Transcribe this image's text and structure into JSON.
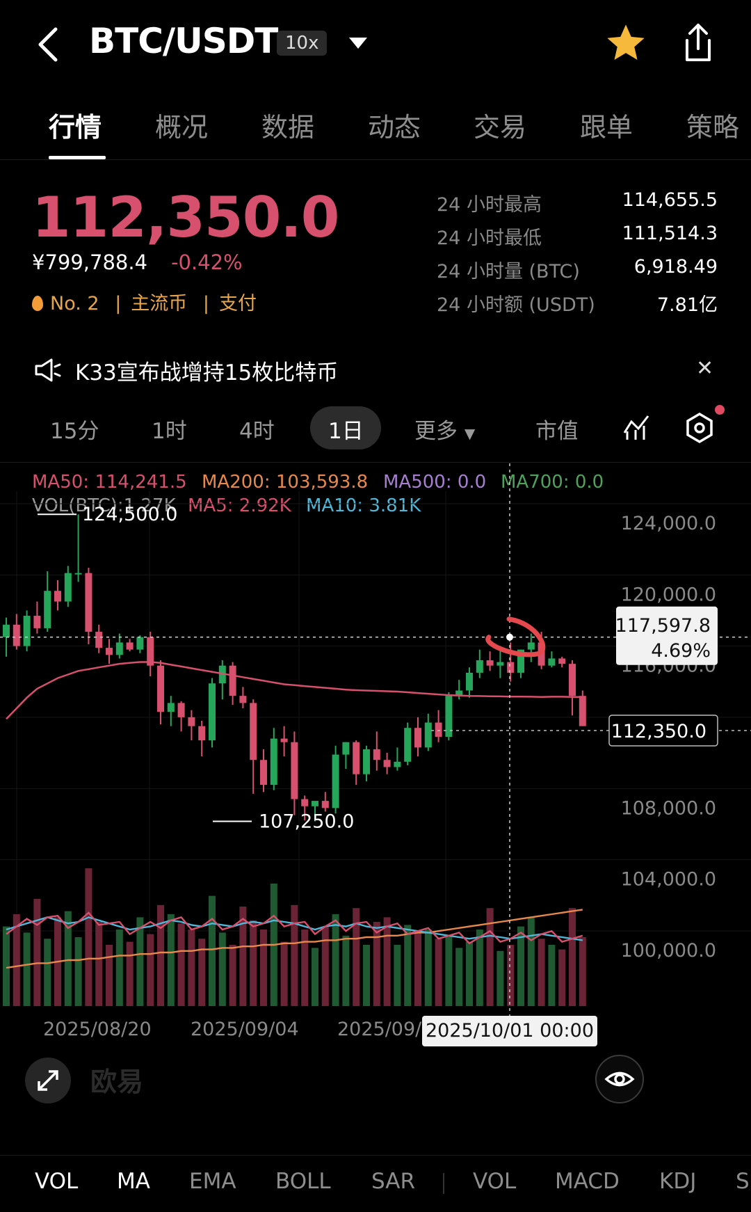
{
  "header": {
    "pair": "BTC/USDT",
    "leverage": "10x"
  },
  "tabs": [
    "行情",
    "概况",
    "数据",
    "动态",
    "交易",
    "跟单",
    "策略"
  ],
  "ticker": {
    "price": "112,350.0",
    "cny": "¥799,788.4",
    "change": "-0.42%",
    "rank": "No. 2",
    "tag1": "主流币",
    "tag2": "支付",
    "stats": [
      {
        "label": "24 小时最高",
        "value": "114,655.5"
      },
      {
        "label": "24 小时最低",
        "value": "111,514.3"
      },
      {
        "label": "24 小时量 (BTC)",
        "value": "6,918.49"
      },
      {
        "label": "24 小时额 (USDT)",
        "value": "7.81亿"
      }
    ]
  },
  "news": {
    "text": "K33宣布战增持15枚比特币"
  },
  "intervals": [
    "15分",
    "1时",
    "4时",
    "1日",
    "更多",
    "市值"
  ],
  "legend": {
    "ma50": "MA50: 114,241.5",
    "ma200": "MA200: 103,593.8",
    "ma500": "MA500: 0.0",
    "ma700": "MA700: 0.0",
    "vol": "VOL(BTC):1.27K",
    "vma5": "MA5: 2.92K",
    "vma10": "MA10: 3.81K"
  },
  "colors": {
    "up": "#26a65b",
    "down": "#d7506e",
    "ma50": "#d7506e",
    "ma200": "#e8884b",
    "ma500": "#a77fd0",
    "ma700": "#4ea35c",
    "vma10": "#4fb8d8"
  },
  "watermark": "欧易",
  "indicators": [
    "VOL",
    "MA",
    "EMA",
    "BOLL",
    "SAR",
    "VOL",
    "MACD",
    "KDJ",
    "S"
  ],
  "chart_data": {
    "type": "candlestick",
    "y_ticks": [
      "124,000.0",
      "120,000.0",
      "116,000.0",
      "112,000.0",
      "108,000.0",
      "104,000.0",
      "100,000.0"
    ],
    "x_ticks": [
      "2025/08/20",
      "2025/09/04",
      "2025/09/"
    ],
    "ylim": [
      97000,
      126000
    ],
    "high_label": "124,500.0",
    "low_label": "107,250.0",
    "crosshair": {
      "price": "117,597.8",
      "pct": "4.69%",
      "date": "2025/10/01 00:00"
    },
    "last_price": "112,350.0",
    "candles": [
      [
        117600,
        118700,
        116500,
        118300
      ],
      [
        118300,
        118900,
        116900,
        117100
      ],
      [
        117100,
        119100,
        116800,
        118800
      ],
      [
        118800,
        119600,
        117800,
        118100
      ],
      [
        118100,
        121300,
        117900,
        120200
      ],
      [
        120200,
        120800,
        119100,
        119600
      ],
      [
        119600,
        121600,
        119300,
        121200
      ],
      [
        121200,
        124500,
        120700,
        121200
      ],
      [
        121200,
        121500,
        117200,
        117900
      ],
      [
        117900,
        118300,
        116700,
        117000
      ],
      [
        117000,
        117500,
        116100,
        116600
      ],
      [
        116600,
        117800,
        116400,
        117300
      ],
      [
        117300,
        117500,
        116800,
        116900
      ],
      [
        116900,
        117700,
        116700,
        117600
      ],
      [
        117600,
        117900,
        115400,
        116000
      ],
      [
        116000,
        116300,
        112700,
        113400
      ],
      [
        113400,
        114300,
        112600,
        113900
      ],
      [
        113900,
        114000,
        112300,
        113100
      ],
      [
        113100,
        113500,
        111800,
        112600
      ],
      [
        112600,
        112900,
        110900,
        111800
      ],
      [
        111800,
        115300,
        111400,
        115000
      ],
      [
        115000,
        116300,
        114100,
        116000
      ],
      [
        116000,
        116200,
        113800,
        114300
      ],
      [
        114300,
        114800,
        113600,
        113900
      ],
      [
        113900,
        114100,
        108800,
        110700
      ],
      [
        110700,
        111300,
        108900,
        109300
      ],
      [
        109300,
        112500,
        109000,
        111900
      ],
      [
        111900,
        112600,
        110900,
        111700
      ],
      [
        111700,
        112300,
        107600,
        108500
      ],
      [
        108500,
        108700,
        107300,
        108100
      ],
      [
        108100,
        108300,
        107250,
        108400
      ],
      [
        108400,
        108900,
        107800,
        108000
      ],
      [
        108000,
        111500,
        107700,
        111000
      ],
      [
        111000,
        111700,
        110200,
        111700
      ],
      [
        111700,
        111800,
        109300,
        109900
      ],
      [
        109900,
        111500,
        109500,
        111300
      ],
      [
        111300,
        112300,
        110100,
        110700
      ],
      [
        110700,
        111100,
        109900,
        110300
      ],
      [
        110300,
        111400,
        110100,
        110600
      ],
      [
        110600,
        112800,
        110400,
        112500
      ],
      [
        112500,
        113100,
        110900,
        111400
      ],
      [
        111400,
        113300,
        111200,
        112800
      ],
      [
        112800,
        113500,
        111700,
        112000
      ],
      [
        112000,
        114500,
        111800,
        114300
      ],
      [
        114300,
        115200,
        114100,
        114600
      ],
      [
        114600,
        115900,
        114200,
        115600
      ],
      [
        115600,
        116900,
        115300,
        116300
      ],
      [
        116300,
        116800,
        115700,
        116000
      ],
      [
        116000,
        117100,
        115300,
        116200
      ],
      [
        116200,
        117300,
        115100,
        115600
      ],
      [
        115600,
        116900,
        115300,
        116900
      ],
      [
        116900,
        117800,
        116200,
        117300
      ],
      [
        117300,
        117900,
        115800,
        116000
      ],
      [
        116000,
        116800,
        115900,
        116400
      ],
      [
        116400,
        116500,
        115900,
        116100
      ],
      [
        116100,
        116300,
        113200,
        114300
      ],
      [
        114300,
        114600,
        112600,
        112600
      ]
    ],
    "ma50": [
      113000,
      113600,
      114200,
      114700,
      115000,
      115300,
      115500,
      115700,
      115800,
      115900,
      116000,
      116100,
      116150,
      116200,
      116200,
      116150,
      116050,
      115950,
      115850,
      115750,
      115650,
      115550,
      115450,
      115350,
      115250,
      115150,
      115050,
      114950,
      114900,
      114850,
      114800,
      114750,
      114700,
      114650,
      114620,
      114600,
      114580,
      114560,
      114540,
      114500,
      114460,
      114420,
      114380,
      114340,
      114320,
      114300,
      114290,
      114280,
      114270,
      114260,
      114260,
      114250,
      114240,
      114250,
      114250,
      114240,
      114241.5
    ],
    "volume": [
      52,
      60,
      48,
      70,
      44,
      58,
      62,
      45,
      90,
      55,
      40,
      50,
      42,
      58,
      47,
      66,
      60,
      54,
      50,
      44,
      72,
      48,
      40,
      65,
      56,
      50,
      80,
      42,
      66,
      50,
      38,
      52,
      60,
      46,
      64,
      40,
      55,
      58,
      40,
      53,
      48,
      50,
      44,
      46,
      38,
      42,
      50,
      64,
      36,
      40,
      52,
      58,
      44,
      40,
      37,
      64,
      45
    ],
    "vol_ma5": [
      50,
      52,
      54,
      56,
      58,
      56,
      54,
      55,
      58,
      56,
      54,
      52,
      50,
      51,
      52,
      54,
      56,
      55,
      53,
      52,
      54,
      53,
      52,
      54,
      55,
      54,
      56,
      55,
      54,
      52,
      50,
      52,
      53,
      52,
      54,
      52,
      51,
      52,
      51,
      50,
      49,
      48,
      47,
      46,
      45,
      44,
      45,
      46,
      45,
      44,
      45,
      46,
      47,
      46,
      45,
      44,
      43
    ],
    "vol_ma200": [
      25,
      26,
      27,
      28,
      28,
      29,
      30,
      30,
      31,
      31,
      32,
      33,
      33,
      34,
      34,
      35,
      35,
      36,
      36,
      37,
      37,
      38,
      38,
      39,
      39,
      40,
      40,
      41,
      41,
      42,
      42,
      43,
      43,
      44,
      44,
      45,
      45,
      46,
      46,
      47,
      48,
      48,
      49,
      50,
      51,
      52,
      53,
      54,
      55,
      56,
      57,
      58,
      59,
      60,
      61,
      62,
      63
    ]
  }
}
